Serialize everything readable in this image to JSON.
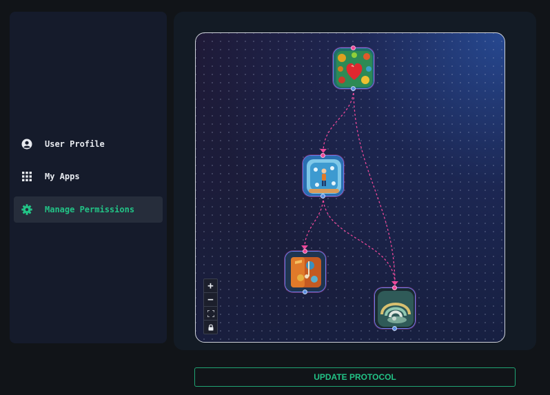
{
  "sidebar": {
    "items": [
      {
        "label": "User Profile",
        "icon": "user-circle-icon",
        "active": false
      },
      {
        "label": "My Apps",
        "icon": "grid-icon",
        "active": false
      },
      {
        "label": "Manage Permissions",
        "icon": "gear-icon",
        "active": true
      }
    ]
  },
  "flow": {
    "nodes": [
      {
        "name": "fruit-heart-app"
      },
      {
        "name": "game-figure-app"
      },
      {
        "name": "music-block-app"
      },
      {
        "name": "swirl-app"
      }
    ],
    "edges": [
      {
        "from": "fruit-heart-app",
        "to": "game-figure-app"
      },
      {
        "from": "fruit-heart-app",
        "to": "swirl-app"
      },
      {
        "from": "game-figure-app",
        "to": "music-block-app"
      },
      {
        "from": "game-figure-app",
        "to": "swirl-app"
      }
    ]
  },
  "controls": {
    "zoom_in": "+",
    "zoom_out": "−"
  },
  "actions": {
    "update_label": "UPDATE PROTOCOL"
  },
  "colors": {
    "accent": "#22c386",
    "edge": "#ec4899",
    "node_border": "#6b7ef0",
    "handle_out": "#5b8ee0"
  }
}
